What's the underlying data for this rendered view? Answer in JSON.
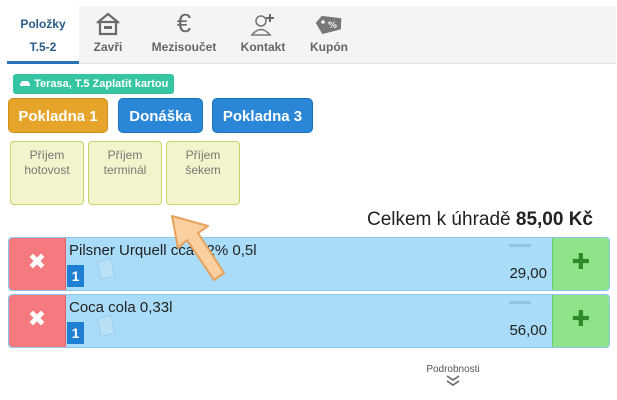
{
  "tabs": {
    "items_line1": "Položky",
    "items_line2": "T.5-2",
    "close": "Zavři",
    "subtotal": "Mezisoučet",
    "contact": "Kontakt",
    "coupon": "Kupón"
  },
  "table_tag": "Terasa, T.5 Zaplatit kartou",
  "registers": [
    "Pokladna 1",
    "Donáška",
    "Pokladna 3"
  ],
  "payments": [
    {
      "l1": "Příjem",
      "l2": "hotovost"
    },
    {
      "l1": "Příjem",
      "l2": "terminál"
    },
    {
      "l1": "Příjem",
      "l2": "šekem"
    }
  ],
  "total": {
    "label": "Celkem k úhradě",
    "amount": "85,00 Kč"
  },
  "order_items": [
    {
      "name": "Pilsner Urquell cca 12% 0,5l",
      "qty": "1",
      "price": "29,00"
    },
    {
      "name": "Coca cola 0,33l",
      "qty": "1",
      "price": "56,00"
    }
  ],
  "details_label": "Podrobnosti",
  "colors": {
    "accent_blue": "#2a86d6",
    "orange": "#e6a52a",
    "delete_red": "#f47a7f",
    "add_green": "#8fe48b",
    "tag_teal": "#35c5a2"
  },
  "icons": {
    "close": "house-icon",
    "subtotal": "euro-icon",
    "contact": "person-add-icon",
    "coupon": "coupon-tag-icon",
    "delete": "x-icon",
    "add": "plus-icon",
    "details": "double-chevron-down-icon"
  }
}
